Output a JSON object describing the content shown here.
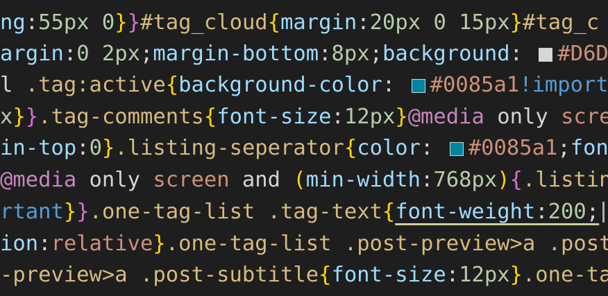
{
  "colors": {
    "background": "#1e1e1e",
    "property": "#9cdcfe",
    "number": "#b5cea8",
    "selector": "#d7ba7d",
    "brace": "#ffd700",
    "brace_alt": "#da70d6",
    "punctuation": "#d4d4d4",
    "keyword": "#c586c0",
    "value": "#ce9178",
    "constant": "#569cd6"
  },
  "lines": [
    {
      "tokens": [
        {
          "t": "ng",
          "c": "#9cdcfe"
        },
        {
          "t": ":",
          "c": "#d4d4d4"
        },
        {
          "t": "55px 0",
          "c": "#b5cea8"
        },
        {
          "t": "}",
          "c": "#ffd700"
        },
        {
          "t": "}",
          "c": "#da70d6"
        },
        {
          "t": "#tag_cloud",
          "c": "#d7ba7d"
        },
        {
          "t": "{",
          "c": "#ffd700"
        },
        {
          "t": "margin",
          "c": "#9cdcfe"
        },
        {
          "t": ":",
          "c": "#d4d4d4"
        },
        {
          "t": "20px 0 15px",
          "c": "#b5cea8"
        },
        {
          "t": "}",
          "c": "#ffd700"
        },
        {
          "t": "#tag_c",
          "c": "#d7ba7d"
        }
      ]
    },
    {
      "tokens": [
        {
          "t": "argin",
          "c": "#9cdcfe"
        },
        {
          "t": ":",
          "c": "#d4d4d4"
        },
        {
          "t": "0 2px",
          "c": "#b5cea8"
        },
        {
          "t": ";",
          "c": "#d4d4d4"
        },
        {
          "t": "margin-bottom",
          "c": "#9cdcfe"
        },
        {
          "t": ":",
          "c": "#d4d4d4"
        },
        {
          "t": "8px",
          "c": "#b5cea8"
        },
        {
          "t": ";",
          "c": "#d4d4d4"
        },
        {
          "t": "background",
          "c": "#9cdcfe"
        },
        {
          "t": ": ",
          "c": "#d4d4d4"
        },
        {
          "swatch": "#d6d6d6"
        },
        {
          "t": "#D6D",
          "c": "#ce9178"
        }
      ]
    },
    {
      "tokens": [
        {
          "t": "l ",
          "c": "#d4d4d4"
        },
        {
          "t": ".tag:active",
          "c": "#d7ba7d"
        },
        {
          "t": "{",
          "c": "#ffd700"
        },
        {
          "t": "background-color",
          "c": "#9cdcfe"
        },
        {
          "t": ": ",
          "c": "#d4d4d4"
        },
        {
          "swatch": "#0085a1"
        },
        {
          "t": "#0085a1",
          "c": "#ce9178"
        },
        {
          "t": "!import",
          "c": "#569cd6"
        }
      ]
    },
    {
      "tokens": [
        {
          "t": "x",
          "c": "#b5cea8"
        },
        {
          "t": "}",
          "c": "#ffd700"
        },
        {
          "t": "}",
          "c": "#da70d6"
        },
        {
          "t": ".tag-comments",
          "c": "#d7ba7d"
        },
        {
          "t": "{",
          "c": "#ffd700"
        },
        {
          "t": "font-size",
          "c": "#9cdcfe"
        },
        {
          "t": ":",
          "c": "#d4d4d4"
        },
        {
          "t": "12px",
          "c": "#b5cea8"
        },
        {
          "t": "}",
          "c": "#ffd700"
        },
        {
          "t": "@media",
          "c": "#c586c0"
        },
        {
          "t": " only ",
          "c": "#d4d4d4"
        },
        {
          "t": "scre",
          "c": "#ce9178"
        }
      ]
    },
    {
      "tokens": [
        {
          "t": "in-top",
          "c": "#9cdcfe"
        },
        {
          "t": ":",
          "c": "#d4d4d4"
        },
        {
          "t": "0",
          "c": "#b5cea8"
        },
        {
          "t": "}",
          "c": "#ffd700"
        },
        {
          "t": ".listing-seperator",
          "c": "#d7ba7d"
        },
        {
          "t": "{",
          "c": "#ffd700"
        },
        {
          "t": "color",
          "c": "#9cdcfe"
        },
        {
          "t": ": ",
          "c": "#d4d4d4"
        },
        {
          "swatch": "#0085a1"
        },
        {
          "t": "#0085a1",
          "c": "#ce9178"
        },
        {
          "t": ";",
          "c": "#d4d4d4"
        },
        {
          "t": "font",
          "c": "#9cdcfe"
        }
      ]
    },
    {
      "tokens": [
        {
          "t": "@media",
          "c": "#c586c0"
        },
        {
          "t": " only ",
          "c": "#d4d4d4"
        },
        {
          "t": "screen",
          "c": "#ce9178"
        },
        {
          "t": " and ",
          "c": "#d4d4d4"
        },
        {
          "t": "(",
          "c": "#ffd700"
        },
        {
          "t": "min-width",
          "c": "#9cdcfe"
        },
        {
          "t": ":",
          "c": "#d4d4d4"
        },
        {
          "t": "768px",
          "c": "#b5cea8"
        },
        {
          "t": ")",
          "c": "#ffd700"
        },
        {
          "t": "{",
          "c": "#da70d6"
        },
        {
          "t": ".listin",
          "c": "#d7ba7d"
        }
      ]
    },
    {
      "tokens": [
        {
          "t": "rtant",
          "c": "#569cd6"
        },
        {
          "t": "}",
          "c": "#ffd700"
        },
        {
          "t": "}",
          "c": "#da70d6"
        },
        {
          "t": ".one-tag-list .tag-text",
          "c": "#d7ba7d"
        },
        {
          "t": "{",
          "c": "#ffd700"
        },
        {
          "t": "font-weight",
          "c": "#9cdcfe",
          "u": true
        },
        {
          "t": ":",
          "c": "#d4d4d4",
          "u": true
        },
        {
          "t": "200",
          "c": "#b5cea8",
          "u": true
        },
        {
          "t": ";",
          "c": "#d4d4d4",
          "u": true
        }
      ]
    },
    {
      "tokens": [
        {
          "t": "ion",
          "c": "#9cdcfe"
        },
        {
          "t": ":",
          "c": "#d4d4d4"
        },
        {
          "t": "relative",
          "c": "#ce9178"
        },
        {
          "t": "}",
          "c": "#ffd700"
        },
        {
          "t": ".one-tag-list .post-preview>a .post",
          "c": "#d7ba7d"
        }
      ]
    },
    {
      "tokens": [
        {
          "t": "-preview>a .post-subtitle",
          "c": "#d7ba7d"
        },
        {
          "t": "{",
          "c": "#ffd700"
        },
        {
          "t": "font-size",
          "c": "#9cdcfe"
        },
        {
          "t": ":",
          "c": "#d4d4d4"
        },
        {
          "t": "12px",
          "c": "#b5cea8"
        },
        {
          "t": "}",
          "c": "#ffd700"
        },
        {
          "t": ".one-ta",
          "c": "#d7ba7d"
        }
      ]
    }
  ]
}
